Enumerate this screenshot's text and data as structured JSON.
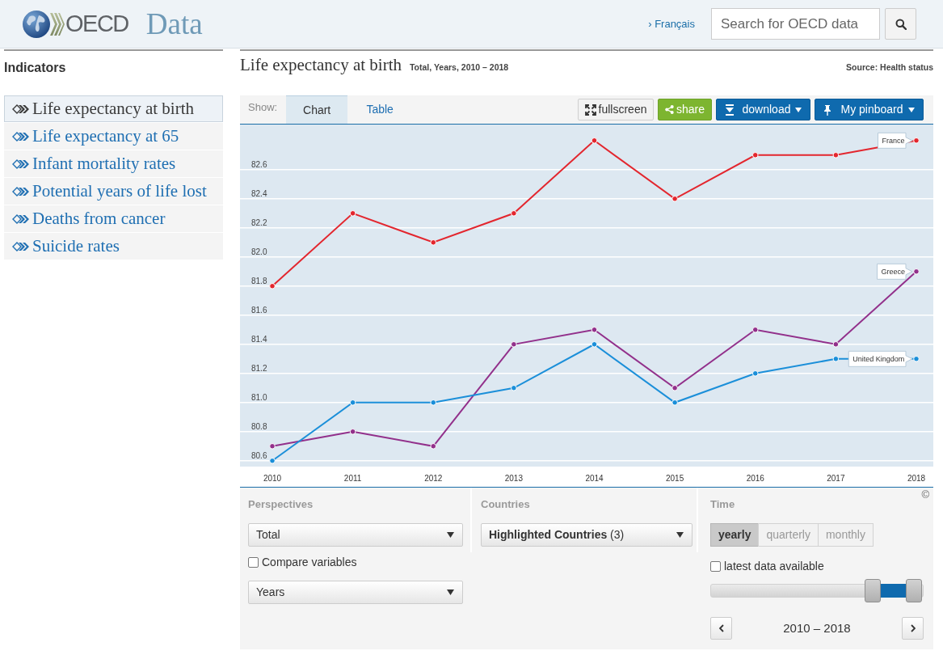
{
  "header": {
    "logo_text": "OECD",
    "site_name": "Data",
    "language_link": "› Français",
    "search": {
      "placeholder": "Search for OECD data"
    }
  },
  "sidebar": {
    "title": "Indicators",
    "items": [
      {
        "label": "Life expectancy at birth",
        "selected": true
      },
      {
        "label": "Life expectancy at 65",
        "selected": false
      },
      {
        "label": "Infant mortality rates",
        "selected": false
      },
      {
        "label": "Potential years of life lost",
        "selected": false
      },
      {
        "label": "Deaths from cancer",
        "selected": false
      },
      {
        "label": "Suicide rates",
        "selected": false
      }
    ]
  },
  "indicator": {
    "title": "Life expectancy at birth",
    "subtitle": "Total, Years, 2010 – 2018",
    "source": "Source: Health status"
  },
  "toolbar": {
    "show_label": "Show:",
    "tabs": [
      {
        "label": "Chart",
        "selected": true
      },
      {
        "label": "Table",
        "selected": false
      }
    ],
    "buttons": [
      {
        "kind": "fullscreen",
        "label": "fullscreen"
      },
      {
        "kind": "share",
        "label": "share"
      },
      {
        "kind": "download",
        "label": "download"
      },
      {
        "kind": "pinboard",
        "label": "My pinboard"
      }
    ]
  },
  "chart": {
    "chart_data": {
      "type": "line",
      "grid": true,
      "categories": [
        "2010",
        "2011",
        "2012",
        "2013",
        "2014",
        "2015",
        "2016",
        "2017",
        "2018"
      ],
      "series": [
        {
          "name": "France",
          "color": "#e3262e",
          "marker": true,
          "values": [
            81.8,
            82.3,
            82.1,
            82.3,
            82.8,
            82.4,
            82.7,
            82.7,
            82.8
          ]
        },
        {
          "name": "Greece",
          "color": "#92308b",
          "marker": true,
          "values": [
            80.7,
            80.8,
            80.7,
            81.4,
            81.5,
            81.1,
            81.5,
            81.4,
            81.9
          ]
        },
        {
          "name": "United Kingdom",
          "color": "#1b8fd9",
          "marker": true,
          "values": [
            80.6,
            81.0,
            81.0,
            81.1,
            81.4,
            81.0,
            81.2,
            81.3,
            81.3
          ]
        }
      ],
      "ylim": [
        80.56,
        82.91
      ],
      "yticks": [
        80.6,
        80.8,
        {
          "value": 81,
          "label": "81.0"
        },
        81.2,
        81.4,
        81.6,
        81.8,
        {
          "value": 82,
          "label": "82.0"
        },
        82.2,
        82.4,
        82.6
      ]
    },
    "copyright": "©"
  },
  "filters": {
    "perspectives": {
      "title": "Perspectives",
      "select": "Total",
      "compare": {
        "label": "Compare variables",
        "checked": false
      },
      "unit_select": "Years"
    },
    "countries": {
      "title": "Countries",
      "select": "**Highlighted Countries** (3)"
    },
    "time": {
      "title": "Time",
      "frequencies": [
        {
          "label": "yearly",
          "selected": true
        },
        {
          "label": "quarterly",
          "selected": false
        },
        {
          "label": "monthly",
          "selected": false
        }
      ],
      "latest": {
        "label": "latest data available",
        "checked": false
      },
      "range_slider": {
        "handles": [
          {
            "level": 0.76
          },
          {
            "level": 0.955
          }
        ]
      },
      "range_label": "2010 – 2018"
    }
  }
}
